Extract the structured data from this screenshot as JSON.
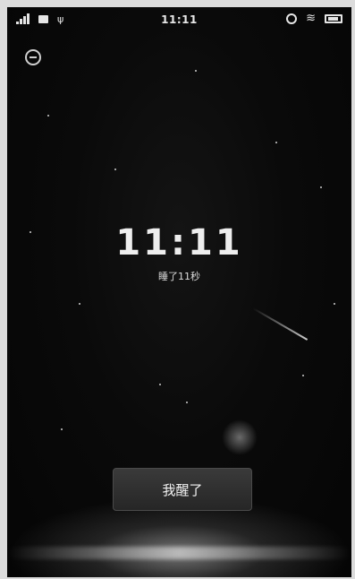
{
  "status_bar": {
    "time": "11:11",
    "signal_icon": "signal-icon",
    "message_icon": "message-icon",
    "usb_icon": "usb-icon",
    "alarm_icon": "alarm-icon",
    "wifi_icon": "wifi-icon",
    "battery_icon": "battery-icon"
  },
  "alarm": {
    "time": "11:11",
    "sleep_duration": "睡了11秒",
    "awake_button_label": "我醒了",
    "dismiss_icon": "minus-circle-icon"
  },
  "colors": {
    "background": "#050505",
    "text": "#eeeeee",
    "button": "#2e2e2e"
  }
}
